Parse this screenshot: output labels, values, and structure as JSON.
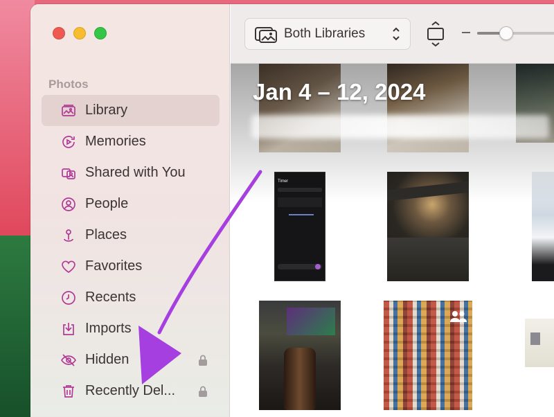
{
  "window": {
    "title": "Photos"
  },
  "sidebar": {
    "section": "Photos",
    "items": [
      {
        "label": "Library",
        "icon": "library-icon",
        "selected": true
      },
      {
        "label": "Memories",
        "icon": "memories-icon"
      },
      {
        "label": "Shared with You",
        "icon": "shared-with-you-icon"
      },
      {
        "label": "People",
        "icon": "people-icon"
      },
      {
        "label": "Places",
        "icon": "places-icon"
      },
      {
        "label": "Favorites",
        "icon": "heart-icon"
      },
      {
        "label": "Recents",
        "icon": "clock-icon"
      },
      {
        "label": "Imports",
        "icon": "import-icon"
      },
      {
        "label": "Hidden",
        "icon": "eye-slash-icon",
        "locked": true
      },
      {
        "label": "Recently Del...",
        "icon": "trash-icon",
        "locked": true
      }
    ]
  },
  "toolbar": {
    "library_select": "Both Libraries",
    "zoom_minus": "–",
    "zoom_level": 0.35
  },
  "grid": {
    "date_heading": "Jan 4 – 12, 2024"
  },
  "colors": {
    "accent": "#b13a97",
    "selected_bg": "#e3d2cf",
    "arrow": "#a53fe0"
  }
}
